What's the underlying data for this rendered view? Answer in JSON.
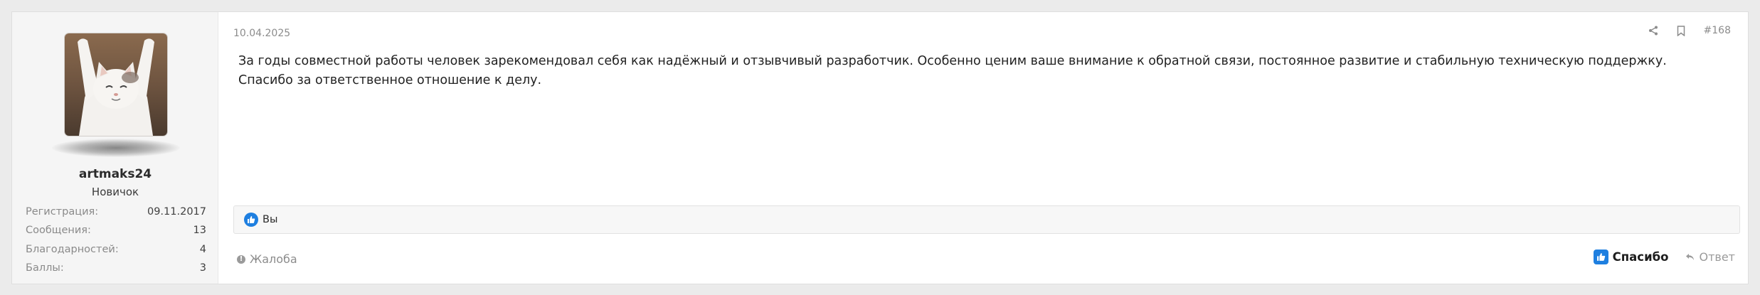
{
  "user": {
    "name": "artmaks24",
    "title": "Новичок",
    "avatar_icon": "cat-photo-avatar",
    "stats": [
      {
        "label": "Регистрация:",
        "value": "09.11.2017"
      },
      {
        "label": "Сообщения:",
        "value": "13"
      },
      {
        "label": "Благодарностей:",
        "value": "4"
      },
      {
        "label": "Баллы:",
        "value": "3"
      }
    ]
  },
  "post": {
    "date": "10.04.2025",
    "number": "#168",
    "text": "За годы совместной работы человек зарекомендовал себя как надёжный и отзывчивый разработчик. Особенно ценим ваше внимание к обратной связи, постоянное развитие и стабильную техническую поддержку. Спасибо за ответственное отношение к делу."
  },
  "reactions": {
    "label": "Вы"
  },
  "actions": {
    "report": "Жалоба",
    "thanks": "Спасибо",
    "reply": "Ответ"
  },
  "colors": {
    "accent": "#1e7fe0",
    "muted": "#8c8c8c"
  }
}
